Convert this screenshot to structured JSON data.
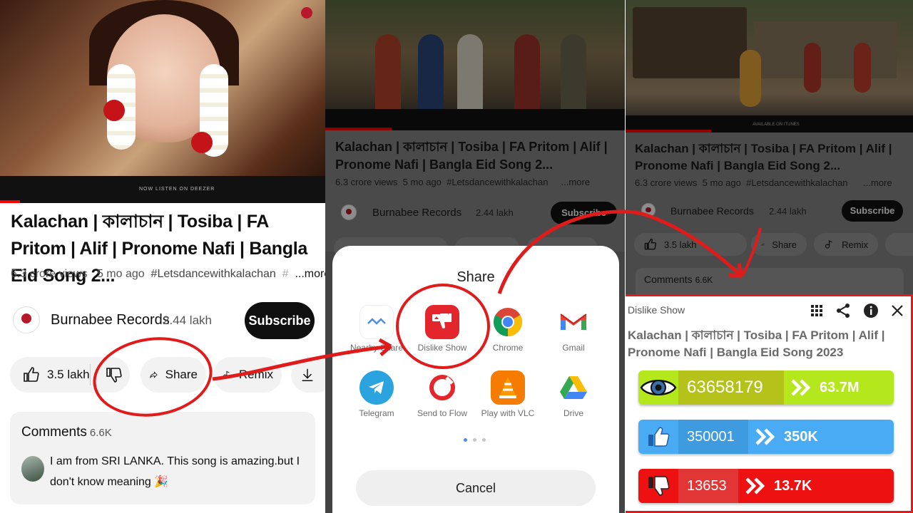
{
  "video": {
    "title": "Kalachan | কালাচান | Tosiba | FA Pritom | Alif | Pronome Nafi | Bangla Eid Song 2...",
    "views": "6.3 crore views",
    "age": "5 mo ago",
    "hashtag": "#Letsdancewithkalachan",
    "more": "...more",
    "channel": "Burnabee Records",
    "subscribers": "2.44 lakh",
    "subscribe_label": "Subscribe"
  },
  "actions": {
    "likes": "3.5 lakh",
    "share": "Share",
    "remix": "Remix"
  },
  "thumb_overlay": {
    "deezer": "NOW LISTEN ON DEEZER",
    "itunes": "AVAILABLE ON ITUNES"
  },
  "comments": {
    "heading": "Comments",
    "count": "6.6K",
    "top_comment": "I am from SRI LANKA. This song is amazing.but I don't know meaning 🎉"
  },
  "share_sheet": {
    "title": "Share",
    "apps": [
      {
        "label": "Nearby Share",
        "icon": "nearby-share-icon"
      },
      {
        "label": "Dislike Show",
        "icon": "dislike-show-icon"
      },
      {
        "label": "Chrome",
        "icon": "chrome-icon"
      },
      {
        "label": "Gmail",
        "icon": "gmail-icon"
      },
      {
        "label": "Telegram",
        "icon": "telegram-icon"
      },
      {
        "label": "Send to Flow",
        "icon": "send-to-flow-icon"
      },
      {
        "label": "Play with VLC",
        "icon": "vlc-icon"
      },
      {
        "label": "Drive",
        "icon": "drive-icon"
      }
    ],
    "cancel": "Cancel"
  },
  "dislike_show": {
    "app_name": "Dislike Show",
    "video_title": "Kalachan | কালাচান | Tosiba | FA Pritom | Alif | Pronome Nafi | Bangla Eid Song 2023",
    "views_raw": "63658179",
    "views_fmt": "63.7M",
    "likes_raw": "350001",
    "likes_fmt": "350K",
    "dislikes_raw": "13653",
    "dislikes_fmt": "13.7K",
    "colors": {
      "views": "#b5e81c",
      "likes": "#4aabf5",
      "dislikes": "#ee1111",
      "highlight": "#e01b1b"
    }
  }
}
